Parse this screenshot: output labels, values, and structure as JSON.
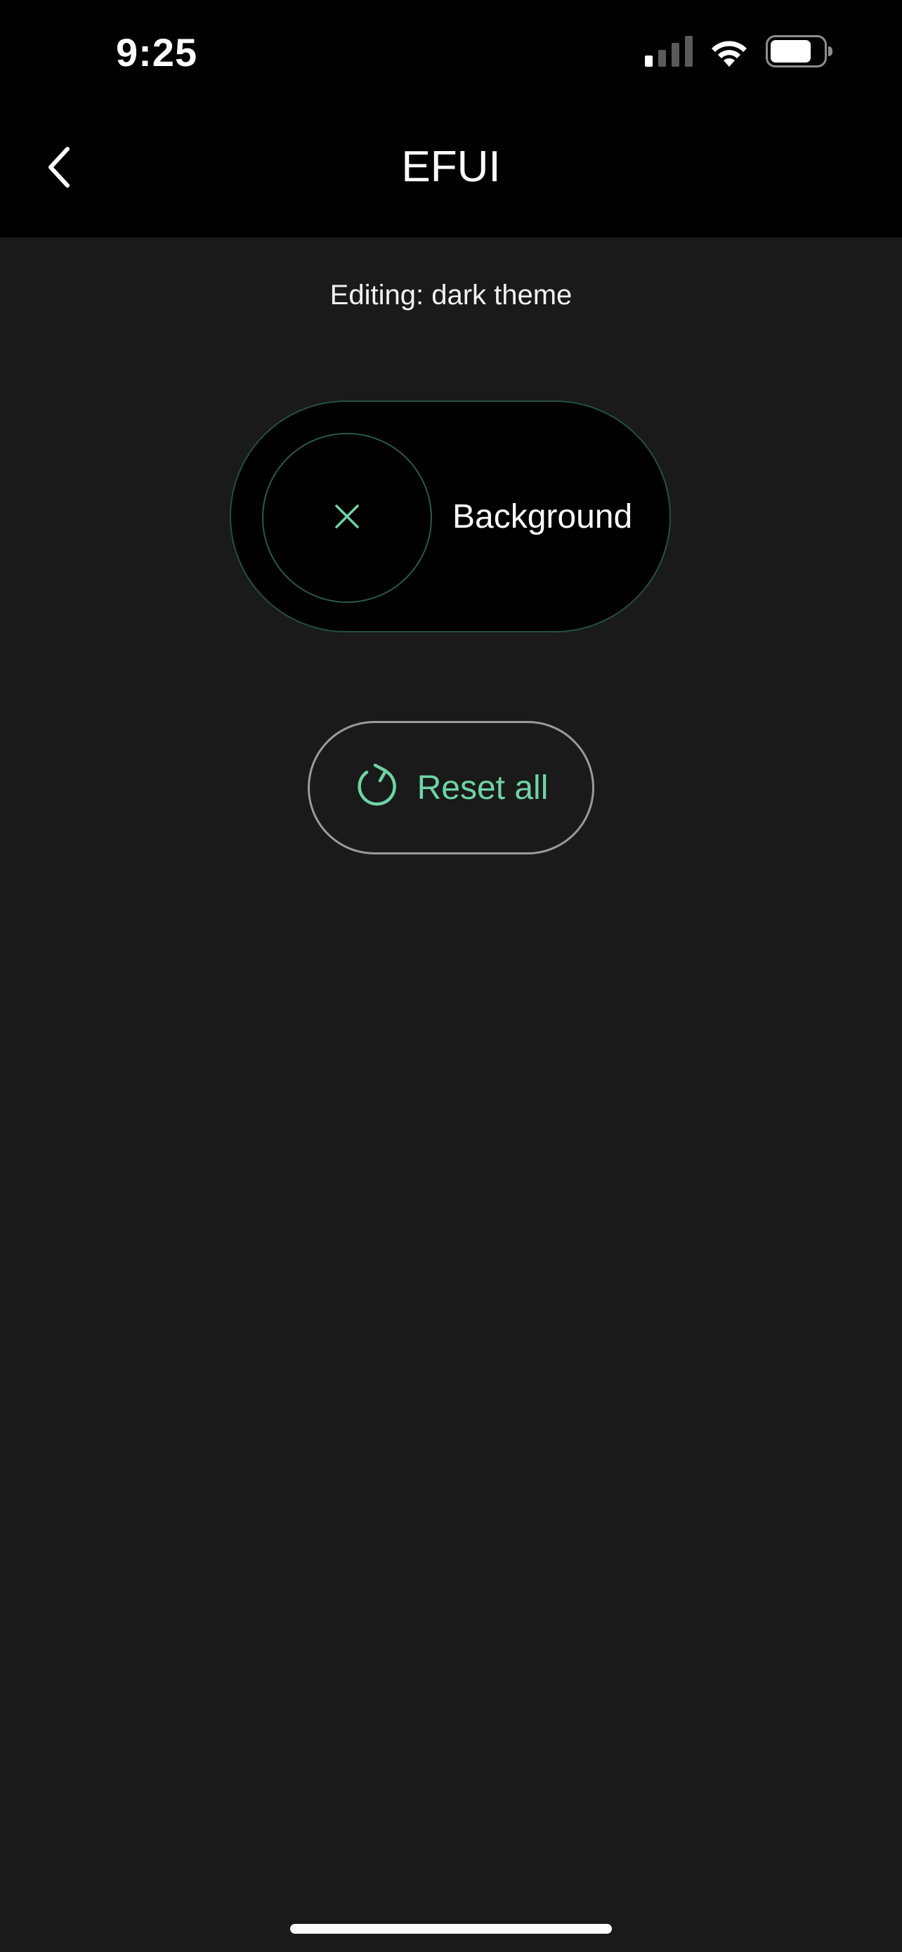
{
  "status_bar": {
    "time": "9:25",
    "icons": [
      "cellular-signal-icon",
      "wifi-icon",
      "battery-icon"
    ]
  },
  "nav": {
    "back_icon": "chevron-left-icon",
    "title": "EFUI"
  },
  "main": {
    "editing_label": "Editing: dark theme",
    "background_chip": {
      "label": "Background",
      "icon": "close-icon"
    },
    "reset_button": {
      "label": "Reset all",
      "icon": "refresh-icon"
    }
  },
  "colors": {
    "accent": "#6fd3a6",
    "background": "#1a1a1a",
    "bar": "#000000",
    "chip_border": "#24503f",
    "reset_border": "#9a9a9a"
  }
}
